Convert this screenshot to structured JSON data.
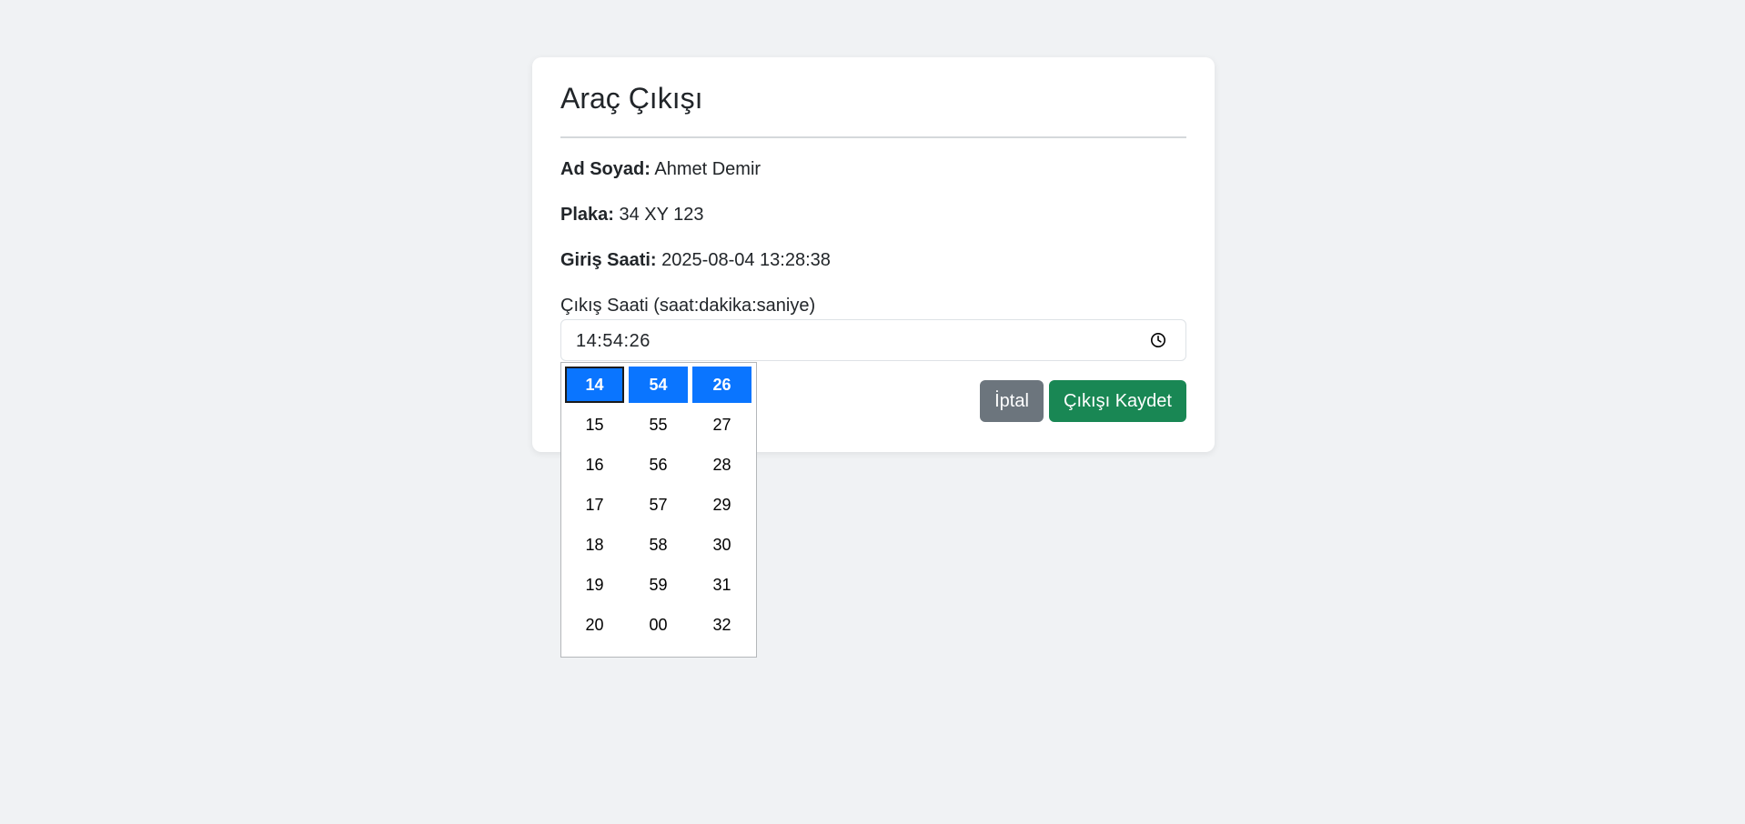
{
  "card": {
    "title": "Araç Çıkışı",
    "name_label": "Ad Soyad:",
    "name_value": "Ahmet Demir",
    "plate_label": "Plaka:",
    "plate_value": "34 XY 123",
    "entry_label": "Giriş Saati:",
    "entry_value": "2025-08-04 13:28:38",
    "exit_label": "Çıkış Saati (saat:dakika:saniye)",
    "exit_value": "14:54:26",
    "cancel_label": "İptal",
    "save_label": "Çıkışı Kaydet"
  },
  "picker": {
    "hours": [
      "14",
      "15",
      "16",
      "17",
      "18",
      "19",
      "20"
    ],
    "minutes": [
      "54",
      "55",
      "56",
      "57",
      "58",
      "59",
      "00"
    ],
    "seconds": [
      "26",
      "27",
      "28",
      "29",
      "30",
      "31",
      "32"
    ]
  },
  "colors": {
    "page_bg": "#f0f2f4",
    "cancel_button": "#6c757d",
    "save_button": "#198754",
    "picker_selected": "#0a75ff"
  },
  "icons": {
    "time_input": "clock-icon"
  }
}
